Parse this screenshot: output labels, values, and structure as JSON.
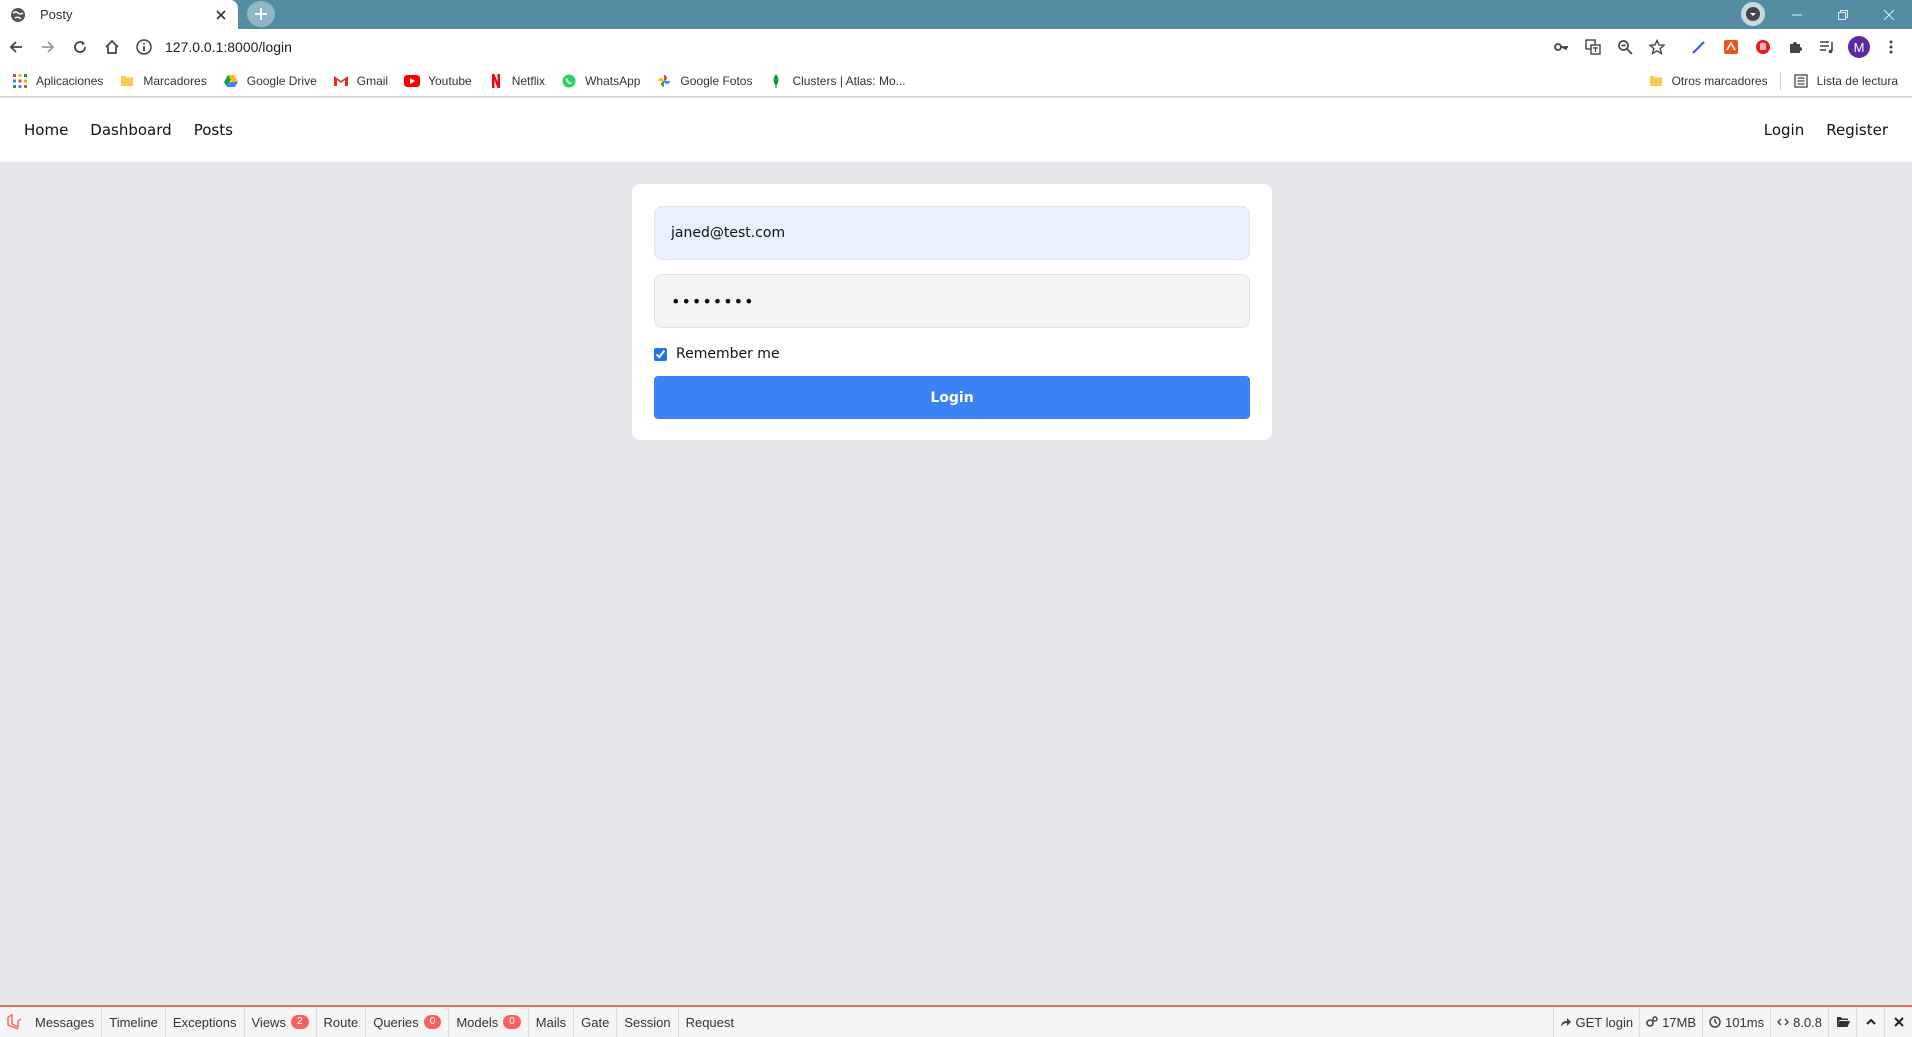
{
  "browser": {
    "tab_title": "Posty",
    "url": "127.0.0.1:8000/login",
    "avatar_letter": "M",
    "bookmarks": [
      {
        "label": "Aplicaciones",
        "icon": "apps-grid-icon"
      },
      {
        "label": "Marcadores",
        "icon": "folder-icon"
      },
      {
        "label": "Google Drive",
        "icon": "drive-icon"
      },
      {
        "label": "Gmail",
        "icon": "gmail-icon"
      },
      {
        "label": "Youtube",
        "icon": "youtube-icon"
      },
      {
        "label": "Netflix",
        "icon": "netflix-icon"
      },
      {
        "label": "WhatsApp",
        "icon": "whatsapp-icon"
      },
      {
        "label": "Google Fotos",
        "icon": "photos-icon"
      },
      {
        "label": "Clusters | Atlas: Mo...",
        "icon": "leaf-icon"
      }
    ],
    "other_bookmarks": "Otros marcadores",
    "reading_list": "Lista de lectura"
  },
  "nav": {
    "home": "Home",
    "dashboard": "Dashboard",
    "posts": "Posts",
    "login": "Login",
    "register": "Register"
  },
  "form": {
    "email_value": "janed@test.com",
    "password_value": "password",
    "remember_label": "Remember me",
    "remember_checked": true,
    "login_button": "Login"
  },
  "debugbar": {
    "tabs": {
      "messages": "Messages",
      "timeline": "Timeline",
      "exceptions": "Exceptions",
      "views": "Views",
      "views_count": "2",
      "route": "Route",
      "queries": "Queries",
      "queries_count": "0",
      "models": "Models",
      "models_count": "0",
      "mails": "Mails",
      "gate": "Gate",
      "session": "Session",
      "request": "Request"
    },
    "request_label": "GET login",
    "memory": "17MB",
    "time": "101ms",
    "php_version": "8.0.8"
  },
  "colors": {
    "tabstrip": "#548da3",
    "primary_button": "#3b82f6",
    "page_background": "#e5e7eb",
    "debugbar_accent": "#f4645f"
  }
}
